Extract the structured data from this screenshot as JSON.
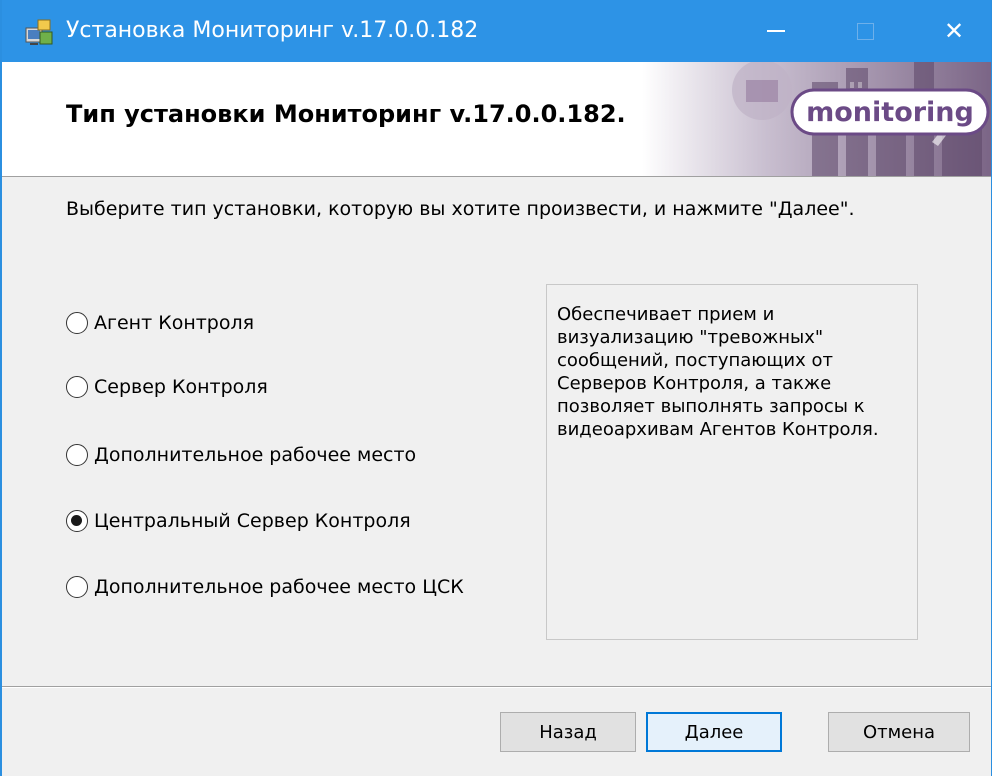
{
  "window": {
    "title": "Установка Мониторинг v.17.0.0.182",
    "minimize_icon": "minimize-icon",
    "maximize_icon": "maximize-icon",
    "close_glyph": "✕"
  },
  "banner": {
    "title": "Тип установки Мониторинг v.17.0.0.182.",
    "logo_text": "monitoring"
  },
  "prompt": "Выберите тип установки, которую вы хотите произвести, и нажмите \"Далее\".",
  "options": [
    {
      "label": "Агент Контроля",
      "checked": false
    },
    {
      "label": "Сервер Контроля",
      "checked": false
    },
    {
      "label": "Дополнительное рабочее место",
      "checked": false
    },
    {
      "label": "Центральный Сервер Контроля",
      "checked": true
    },
    {
      "label": "Дополнительное рабочее место ЦСК",
      "checked": false
    }
  ],
  "description": "Обеспечивает прием и визуализацию \"тревожных\" сообщений, поступающих от Серверов Контроля, а также позволяет выполнять запросы к видеоархивам Агентов Контроля.",
  "buttons": {
    "back": "Назад",
    "next": "Далее",
    "cancel": "Отмена"
  },
  "colors": {
    "titlebar": "#2d93e6",
    "accent": "#0078d7",
    "logo": "#6b4a86"
  }
}
